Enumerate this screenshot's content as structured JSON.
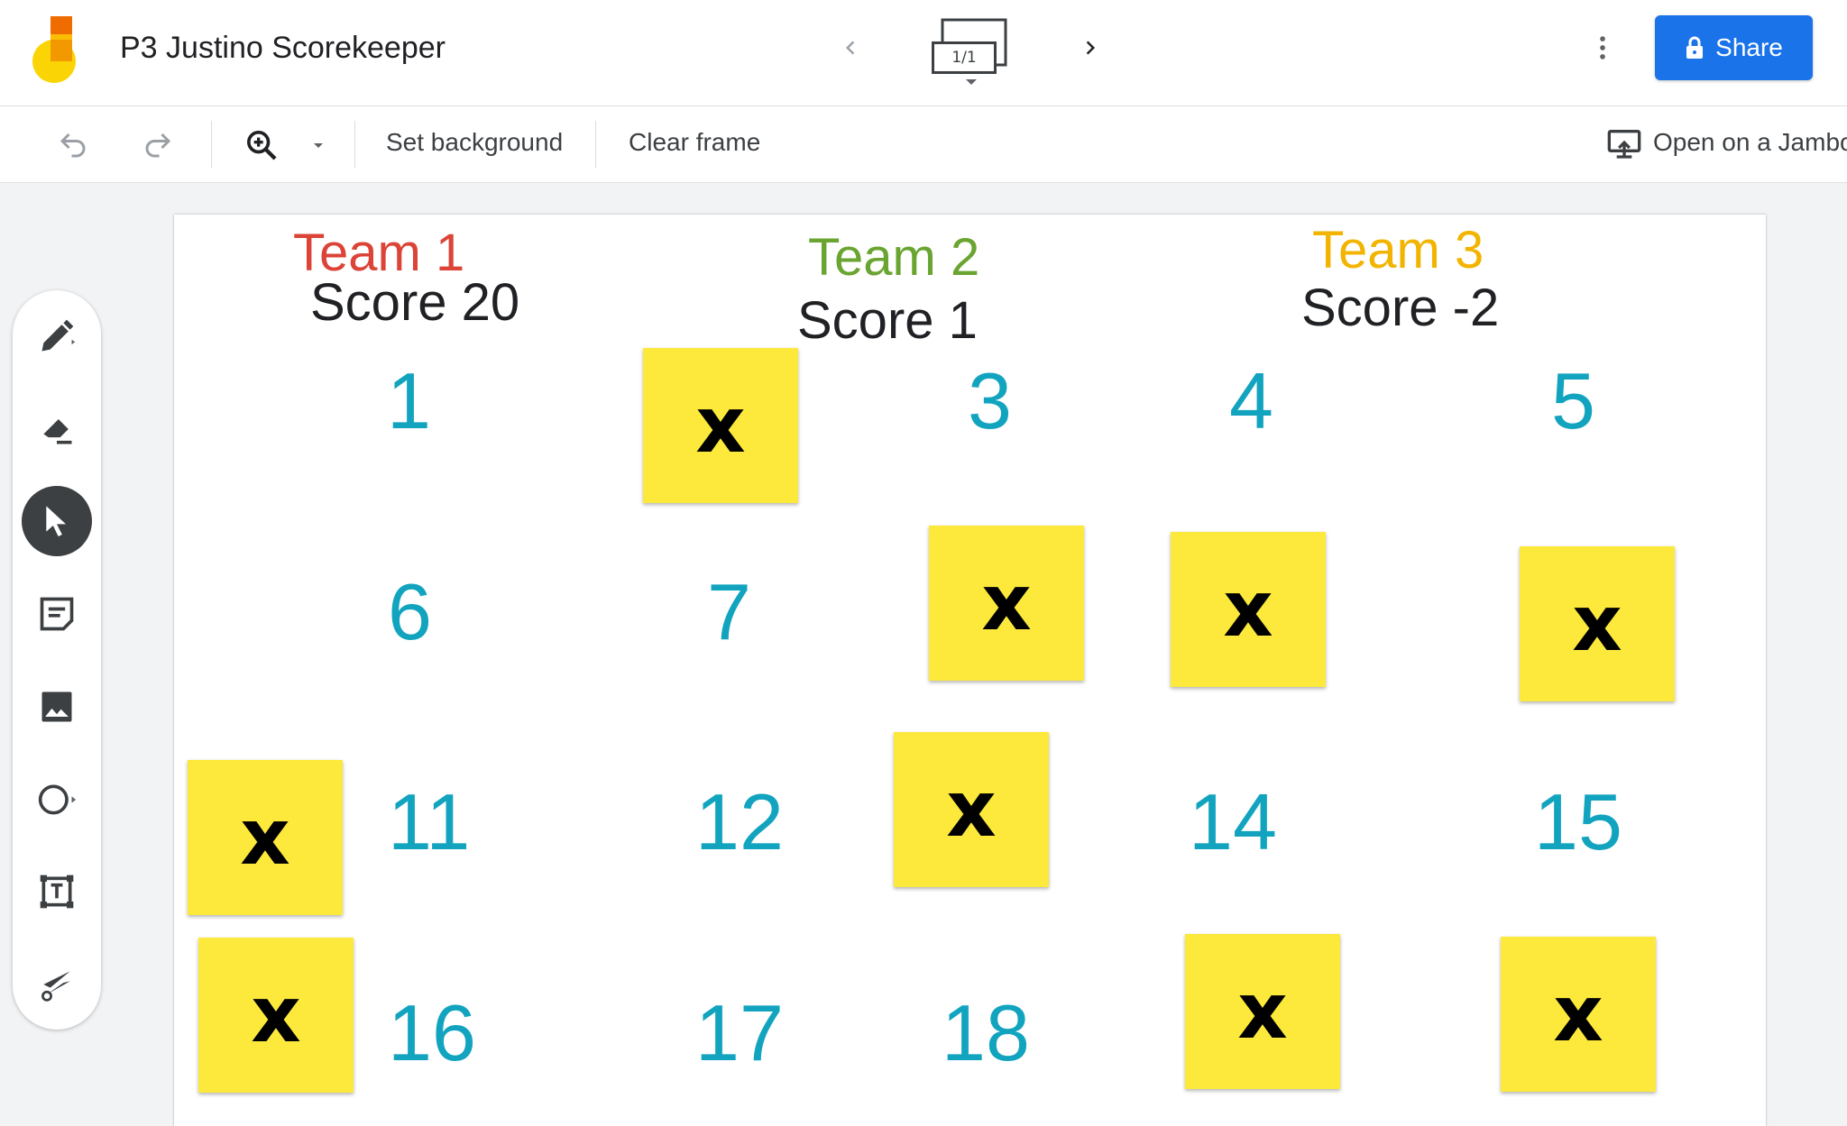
{
  "header": {
    "title": "P3 Justino Scorekeeper",
    "frame_indicator": "1/1",
    "share_label": "Share",
    "logo_icon": "jamboard-logo",
    "prev_icon": "chevron-left-icon",
    "next_icon": "chevron-right-icon",
    "menu_icon": "more-vert-icon"
  },
  "toolbar": {
    "set_background_label": "Set background",
    "clear_frame_label": "Clear frame",
    "open_on_jamboard_label": "Open on a Jamboard"
  },
  "sidebar": {
    "tools": [
      {
        "name": "pen-tool"
      },
      {
        "name": "eraser-tool"
      },
      {
        "name": "select-tool",
        "active": true
      },
      {
        "name": "sticky-note-tool"
      },
      {
        "name": "image-tool"
      },
      {
        "name": "shape-tool"
      },
      {
        "name": "text-box-tool"
      },
      {
        "name": "laser-tool"
      }
    ]
  },
  "board": {
    "teams": [
      {
        "name": "Team 1",
        "score": "Score 20",
        "color": "#db4437"
      },
      {
        "name": "Team 2",
        "score": "Score 1",
        "color": "#6aa431"
      },
      {
        "name": "Team 3",
        "score": "Score -2",
        "color": "#f2b400"
      }
    ],
    "numbers": [
      "1",
      "3",
      "4",
      "5",
      "6",
      "7",
      "11",
      "12",
      "14",
      "15",
      "16",
      "17",
      "18"
    ],
    "sticky_text": "x",
    "sticky_color": "#fce93b",
    "number_color": "#12a4bf"
  }
}
